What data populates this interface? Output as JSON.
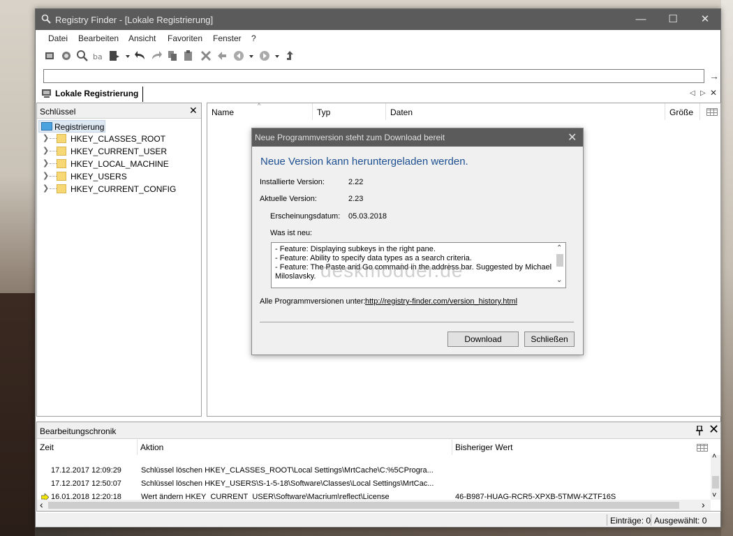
{
  "window": {
    "title": "Registry Finder - [Lokale Registrierung]",
    "minimize": "—",
    "maximize": "☐",
    "close": "✕"
  },
  "menu": [
    "Datei",
    "Bearbeiten",
    "Ansicht",
    "Favoriten",
    "Fenster",
    "?"
  ],
  "address": {
    "value": "",
    "go": "→"
  },
  "tab": {
    "label": "Lokale Registrierung",
    "prev": "◁",
    "next": "▷",
    "close": "✕"
  },
  "left_pane": {
    "header": "Schlüssel",
    "close": "✕",
    "root": "Registrierung",
    "items": [
      "HKEY_CLASSES_ROOT",
      "HKEY_CURRENT_USER",
      "HKEY_LOCAL_MACHINE",
      "HKEY_USERS",
      "HKEY_CURRENT_CONFIG"
    ],
    "chevron": "❯"
  },
  "right_pane": {
    "columns": [
      "Name",
      "Typ",
      "Daten",
      "Größe"
    ]
  },
  "dialog": {
    "title": "Neue Programmversion steht zum Download bereit",
    "close": "✕",
    "heading": "Neue Version kann heruntergeladen werden.",
    "installed_label": "Installierte Version:",
    "installed_value": "2.22",
    "current_label": "Aktuelle Version:",
    "current_value": "2.23",
    "date_label": "Erscheinungsdatum:",
    "date_value": "05.03.2018",
    "whatsnew_label": "Was ist neu:",
    "notes": [
      "- Feature: Displaying subkeys in the right pane.",
      "- Feature: Ability to specify data types as a search criteria.",
      "- Feature: The Paste and Go command in the address bar. Suggested by Michael",
      "Miloslavsky."
    ],
    "watermark": "deskmodder.de",
    "all_versions_label": "Alle Programmversionen unter:",
    "all_versions_link": "http://registry-finder.com/version_history.html",
    "download_button": "Download",
    "close_button": "Schließen",
    "scroll_up": "⌃",
    "scroll_down": "⌄"
  },
  "history": {
    "header": "Bearbeitungschronik",
    "pin": "📌",
    "close": "✕",
    "columns": [
      "Zeit",
      "Aktion",
      "Bisheriger Wert"
    ],
    "rows": [
      {
        "time": "17.12.2017 12:09:29",
        "action": "Schlüssel löschen HKEY_CLASSES_ROOT\\Local Settings\\MrtCache\\C:%5CProgra...",
        "prev": ""
      },
      {
        "time": "17.12.2017 12:50:07",
        "action": "Schlüssel löschen HKEY_USERS\\S-1-5-18\\Software\\Classes\\Local Settings\\MrtCac...",
        "prev": ""
      },
      {
        "time": "16.01.2018 12:20:18",
        "action": "Wert ändern HKEY_CURRENT_USER\\Software\\Macrium\\reflect\\License",
        "prev": "46-B987-HUAG-RCR5-XPXB-5TMW-KZTF16S"
      }
    ],
    "scroll_left": "‹",
    "scroll_right": "›",
    "scroll_up": "˄",
    "scroll_down": "˅"
  },
  "status": {
    "entries": "Einträge: 0",
    "selected": "Ausgewählt: 0"
  },
  "icons": [
    "search-icon",
    "registry-icon",
    "undo-icon",
    "redo-icon",
    "copy-icon",
    "paste-icon",
    "delete-icon",
    "refresh-icon",
    "back-icon",
    "forward-icon",
    "up-icon"
  ]
}
